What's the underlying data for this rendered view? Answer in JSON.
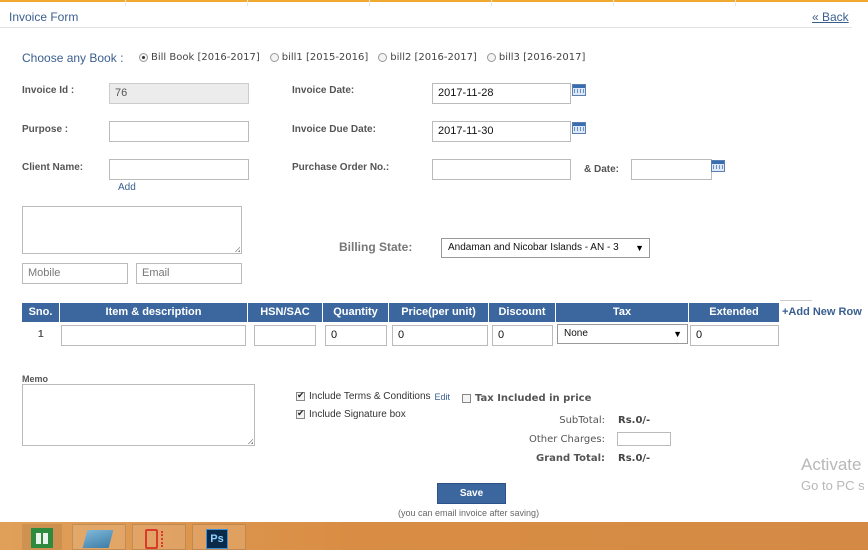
{
  "header": {
    "title": "Invoice Form",
    "back_label": "« Back"
  },
  "book": {
    "label": "Choose any Book :",
    "options": [
      "Bill Book [2016-2017]",
      "bill1 [2015-2016]",
      "bill2 [2016-2017]",
      "bill3 [2016-2017]"
    ],
    "selected_index": 0
  },
  "fields": {
    "invoice_id_label": "Invoice Id :",
    "invoice_id_value": "76",
    "purpose_label": "Purpose :",
    "purpose_value": "",
    "client_name_label": "Client Name:",
    "client_name_value": "",
    "add_label": "Add",
    "invoice_date_label": "Invoice Date:",
    "invoice_date_value": "2017-11-28",
    "due_date_label": "Invoice Due Date:",
    "due_date_value": "2017-11-30",
    "po_label": "Purchase Order No.:",
    "po_value": "",
    "po_date_label": "& Date:",
    "po_date_value": "",
    "address_value": "",
    "mobile_placeholder": "Mobile",
    "email_placeholder": "Email",
    "billing_state_label": "Billing State:",
    "billing_state_value": "Andaman and Nicobar Islands - AN - 3"
  },
  "table": {
    "headers": [
      "Sno.",
      "Item & description",
      "HSN/SAC",
      "Quantity",
      "Price(per unit)",
      "Discount",
      "Tax",
      "Extended"
    ],
    "add_row_label": "+Add New Row",
    "rows": [
      {
        "sno": "1",
        "item": "",
        "hsn": "",
        "quantity": "0",
        "price": "0",
        "discount": "0",
        "tax": "None",
        "extended": "0"
      }
    ]
  },
  "memo": {
    "label": "Memo",
    "value": ""
  },
  "options": {
    "terms_label": "Include Terms & Conditions",
    "terms_checked": true,
    "edit_label": "Edit",
    "tax_included_label": "Tax Included in price",
    "tax_included_checked": false,
    "signature_label": "Include Signature box",
    "signature_checked": true
  },
  "summary": {
    "subtotal_label": "SubTotal:",
    "subtotal_value": "Rs.0/-",
    "other_charges_label": "Other Charges:",
    "other_charges_value": "",
    "grand_total_label": "Grand Total:",
    "grand_total_value": "Rs.0/-"
  },
  "actions": {
    "save_label": "Save",
    "save_note": "(you can email invoice after saving)"
  },
  "watermark": {
    "line1": "Activate",
    "line2": "Go to PC s"
  },
  "taskbar": {
    "ps_label": "Ps"
  },
  "colors": {
    "accent": "#3b679e",
    "link": "#3a5f8f",
    "taskbar": "#d98d44",
    "top_border": "#f0a830"
  },
  "icons": {
    "calendar": "calendar-icon",
    "store": "store-icon",
    "ebook": "ebook-icon",
    "phone": "phone-icon",
    "photoshop": "photoshop-icon"
  }
}
